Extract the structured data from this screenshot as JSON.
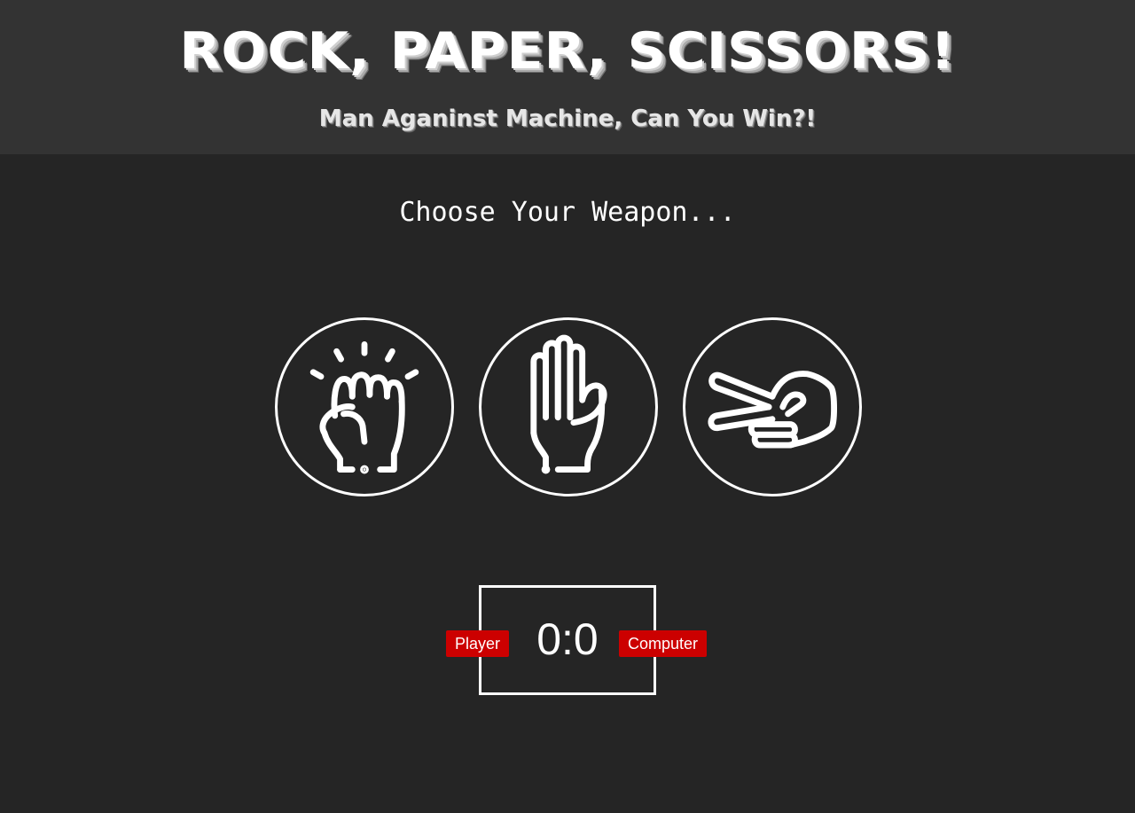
{
  "header": {
    "title": "ROCK, PAPER, SCISSORS!",
    "subtitle": "Man Aganinst Machine, Can You Win?!"
  },
  "main": {
    "prompt": "Choose Your Weapon...",
    "choices": [
      {
        "name": "rock",
        "icon": "fist-icon"
      },
      {
        "name": "paper",
        "icon": "open-hand-icon"
      },
      {
        "name": "scissors",
        "icon": "peace-hand-icon"
      }
    ]
  },
  "scoreboard": {
    "player_label": "Player",
    "score": "0:0",
    "computer_label": "Computer",
    "player_score": 0,
    "computer_score": 0
  },
  "colors": {
    "background": "#252525",
    "header_background": "#333333",
    "badge": "#cc0000",
    "foreground": "#ffffff"
  }
}
